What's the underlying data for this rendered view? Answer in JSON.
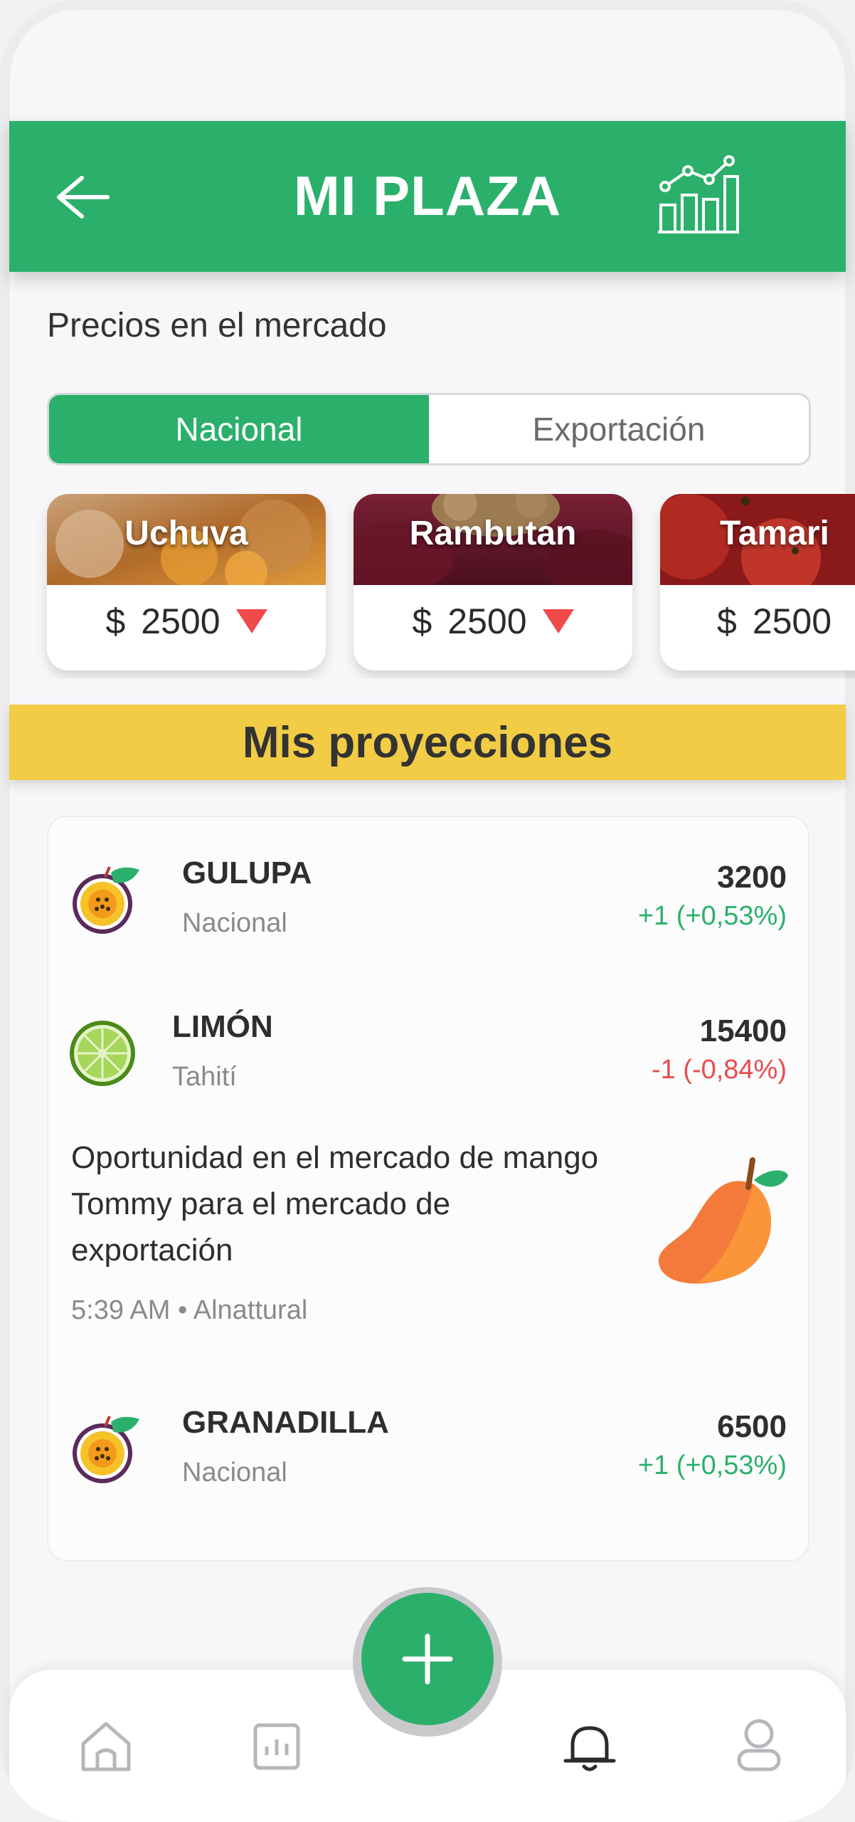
{
  "header": {
    "title": "MI PLAZA",
    "back_icon": "arrow-left-icon",
    "chart_icon": "bar-chart-trend-icon",
    "color": "#2bb06b"
  },
  "market": {
    "section_label": "Precios en el mercado",
    "tabs": [
      {
        "label": "Nacional",
        "active": true
      },
      {
        "label": "Exportación",
        "active": false
      }
    ],
    "cards": [
      {
        "name": "Uchuva",
        "currency": "$",
        "price": "2500",
        "trend": "down"
      },
      {
        "name": "Rambutan",
        "currency": "$",
        "price": "2500",
        "trend": "down"
      },
      {
        "name": "Tamari",
        "currency": "$",
        "price": "2500",
        "trend": "down"
      }
    ]
  },
  "projections": {
    "title": "Mis proyecciones",
    "items": [
      {
        "name": "GULUPA",
        "sub": "Nacional",
        "value": "3200",
        "change": "+1 (+0,53%)",
        "direction": "up",
        "icon": "passionfruit-icon"
      },
      {
        "name": "LIMÓN",
        "sub": "Tahití",
        "value": "15400",
        "change": "-1 (-0,84%)",
        "direction": "down",
        "icon": "lime-icon"
      },
      {
        "name": "GRANADILLA",
        "sub": "Nacional",
        "value": "6500",
        "change": "+1 (+0,53%)",
        "direction": "up",
        "icon": "passionfruit-icon"
      }
    ],
    "news": {
      "text": "Oportunidad en el mercado de mango Tommy para el mercado de exportación",
      "meta": "5:39 AM • Alnattural",
      "icon": "mango-icon"
    }
  },
  "fab": {
    "icon": "plus-icon"
  },
  "tabbar": {
    "items": [
      {
        "icon": "home-icon"
      },
      {
        "icon": "stats-icon"
      },
      {
        "icon": "bell-icon",
        "active": true
      },
      {
        "icon": "user-icon"
      }
    ]
  }
}
